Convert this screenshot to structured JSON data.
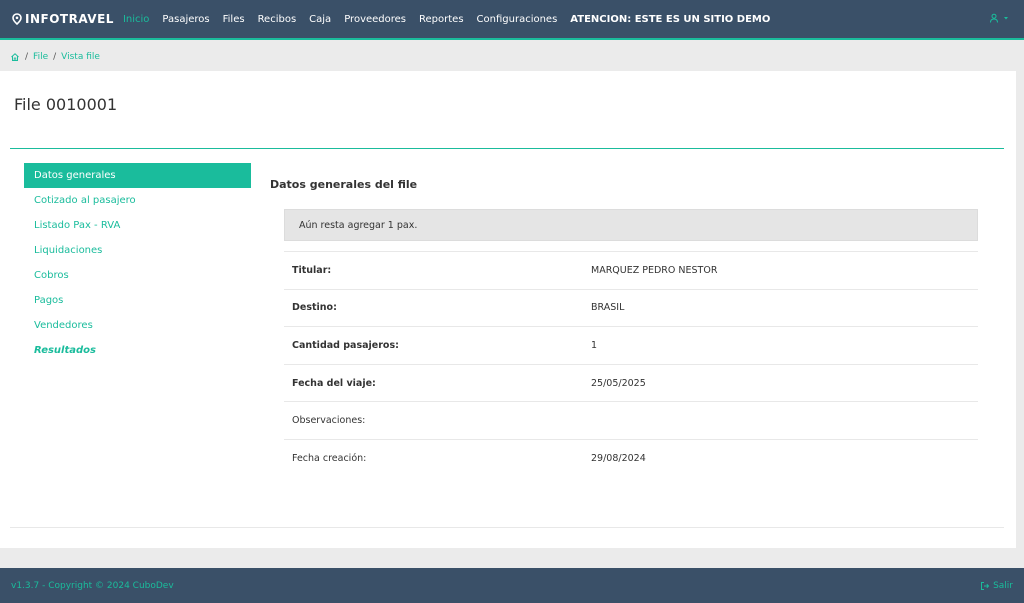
{
  "brand": {
    "name": "INFOTRAVEL"
  },
  "nav": {
    "items": [
      {
        "label": "Inicio",
        "active": true
      },
      {
        "label": "Pasajeros"
      },
      {
        "label": "Files"
      },
      {
        "label": "Recibos"
      },
      {
        "label": "Caja"
      },
      {
        "label": "Proveedores"
      },
      {
        "label": "Reportes"
      },
      {
        "label": "Configuraciones"
      }
    ],
    "warning": "ATENCION: ESTE ES UN SITIO DEMO"
  },
  "breadcrumb": {
    "items": [
      "File",
      "Vista file"
    ]
  },
  "page": {
    "title": "File 0010001"
  },
  "side_nav": {
    "items": [
      {
        "label": "Datos generales"
      },
      {
        "label": "Cotizado al pasajero"
      },
      {
        "label": "Listado Pax - RVA"
      },
      {
        "label": "Liquidaciones"
      },
      {
        "label": "Cobros"
      },
      {
        "label": "Pagos"
      },
      {
        "label": "Vendedores"
      },
      {
        "label": "Resultados"
      }
    ]
  },
  "section": {
    "title": "Datos generales del file",
    "alert": "Aún resta agregar 1 pax.",
    "rows": [
      {
        "label": "Titular:",
        "value": "MARQUEZ PEDRO NESTOR"
      },
      {
        "label": "Destino:",
        "value": "BRASIL"
      },
      {
        "label": "Cantidad pasajeros:",
        "value": "1"
      },
      {
        "label": "Fecha del viaje:",
        "value": "25/05/2025"
      },
      {
        "label": "Observaciones:",
        "value": ""
      },
      {
        "label": "Fecha creación:",
        "value": "29/08/2024"
      }
    ]
  },
  "footer": {
    "copyright": "v1.3.7 - Copyright © 2024 CuboDev",
    "logout": "Salir"
  },
  "colors": {
    "navbar": "#3a5068",
    "accent": "#1abc9c"
  }
}
